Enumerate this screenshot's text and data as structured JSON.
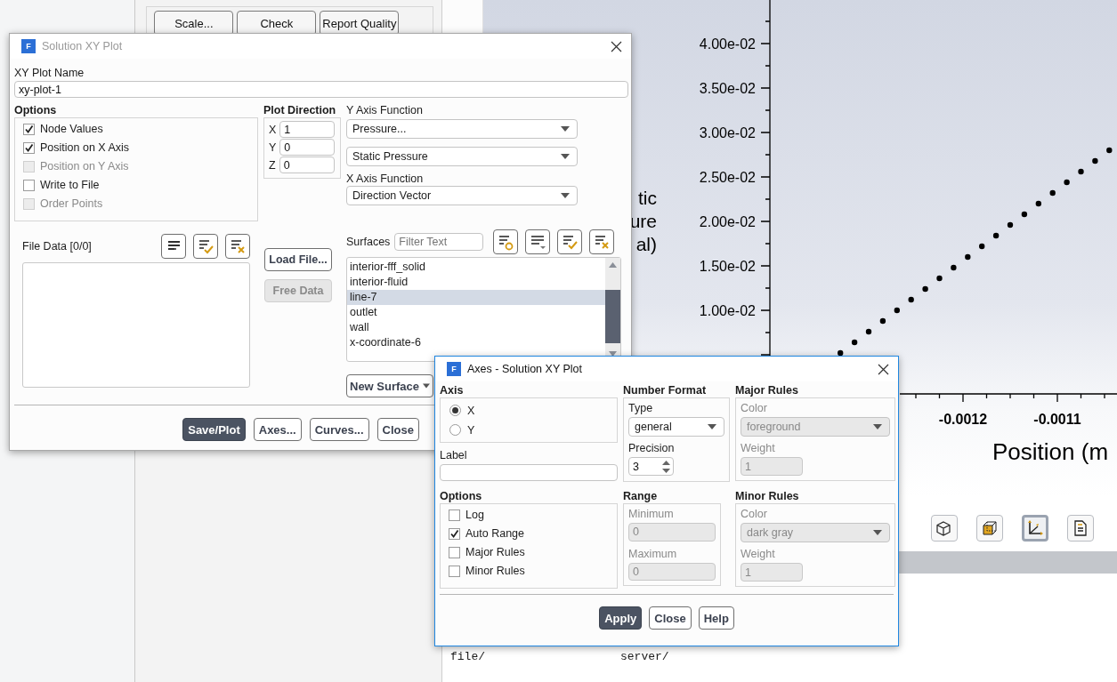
{
  "left_panel": {
    "mesh_buttons": [
      "Scale...",
      "Check",
      "Report Quality"
    ]
  },
  "graphics": {
    "chart_data": {
      "type": "scatter",
      "xlabel": "Position (m",
      "ylabel": "tic ure al)",
      "x": [
        -0.00133,
        -0.001315,
        -0.0013,
        -0.001285,
        -0.00127,
        -0.001255,
        -0.00124,
        -0.001225,
        -0.00121,
        -0.001195,
        -0.00118,
        -0.001165,
        -0.00115,
        -0.001135,
        -0.00112,
        -0.001105,
        -0.00109,
        -0.001075,
        -0.00106,
        -0.001045
      ],
      "series": [
        {
          "color": "#000000",
          "values": [
            0.0052,
            0.0064,
            0.0076,
            0.0088,
            0.01,
            0.0112,
            0.0124,
            0.0136,
            0.0148,
            0.016,
            0.0172,
            0.0184,
            0.0196,
            0.0208,
            0.022,
            0.0232,
            0.0244,
            0.0256,
            0.0268,
            0.028
          ]
        }
      ],
      "xticks": [
        {
          "value": -0.0012,
          "label": "-0.0012"
        },
        {
          "value": -0.0011,
          "label": "-0.0011"
        }
      ],
      "yticks": [
        {
          "value": 0.04,
          "label": "4.00e-02"
        },
        {
          "value": 0.035,
          "label": "3.50e-02"
        },
        {
          "value": 0.03,
          "label": "3.00e-02"
        },
        {
          "value": 0.025,
          "label": "2.50e-02"
        },
        {
          "value": 0.02,
          "label": "2.00e-02"
        },
        {
          "value": 0.015,
          "label": "1.50e-02"
        },
        {
          "value": 0.01,
          "label": "1.00e-02"
        }
      ],
      "xlim": [
        -0.0014047,
        -0.0010368
      ],
      "ylim": [
        0.0006,
        0.0449
      ]
    },
    "toolbar": [
      {
        "kind": "cube",
        "selected": false
      },
      {
        "kind": "box",
        "selected": false
      },
      {
        "kind": "axes",
        "selected": true
      },
      {
        "kind": "note",
        "selected": false
      }
    ]
  },
  "console": {
    "lines": [
      [
        "file/",
        "server/"
      ]
    ]
  },
  "xy_plot_dialog": {
    "title": "Solution XY Plot",
    "icon_letter": "F",
    "active": false,
    "name_label": "XY Plot Name",
    "name_value": "xy-plot-1",
    "options": {
      "label": "Options",
      "items": [
        {
          "label": "Node Values",
          "checked": true,
          "disabled": false
        },
        {
          "label": "Position on X Axis",
          "checked": true,
          "disabled": false
        },
        {
          "label": "Position on Y Axis",
          "checked": false,
          "disabled": true
        },
        {
          "label": "Write to File",
          "checked": false,
          "disabled": false
        },
        {
          "label": "Order Points",
          "checked": false,
          "disabled": true
        }
      ]
    },
    "plot_direction": {
      "label": "Plot Direction",
      "fields": [
        {
          "axis": "X",
          "value": "1"
        },
        {
          "axis": "Y",
          "value": "0"
        },
        {
          "axis": "Z",
          "value": "0"
        }
      ]
    },
    "y_axis_function": {
      "label": "Y Axis Function",
      "selects": [
        "Pressure...",
        "Static Pressure"
      ]
    },
    "x_axis_function": {
      "label": "X Axis Function",
      "select": "Direction Vector"
    },
    "file_data": {
      "label": "File Data  [0/0]",
      "tools": [
        {
          "kind": "list"
        },
        {
          "kind": "check"
        },
        {
          "kind": "clear"
        }
      ]
    },
    "file_buttons": [
      {
        "label": "Load File...",
        "disabled": false
      },
      {
        "label": "Free Data",
        "disabled": true
      }
    ],
    "surfaces": {
      "label": "Surfaces",
      "filter_placeholder": "Filter Text",
      "tools": [
        {
          "kind": "circle"
        },
        {
          "kind": "caret"
        },
        {
          "kind": "check"
        },
        {
          "kind": "clear"
        }
      ],
      "items": [
        {
          "label": "interior-fff_solid",
          "selected": false
        },
        {
          "label": "interior-fluid",
          "selected": false
        },
        {
          "label": "line-7",
          "selected": true
        },
        {
          "label": "outlet",
          "selected": false
        },
        {
          "label": "wall",
          "selected": false
        },
        {
          "label": "x-coordinate-6",
          "selected": false
        }
      ]
    },
    "new_surface": "New Surface",
    "buttons": [
      {
        "label": "Save/Plot",
        "primary": true
      },
      {
        "label": "Axes...",
        "primary": false
      },
      {
        "label": "Curves...",
        "primary": false
      },
      {
        "label": "Close",
        "primary": false
      }
    ]
  },
  "axes_dialog": {
    "title": "Axes - Solution XY Plot",
    "icon_letter": "F",
    "active": true,
    "axis": {
      "label": "Axis",
      "options": [
        {
          "label": "X",
          "selected": true
        },
        {
          "label": "Y",
          "selected": false
        }
      ]
    },
    "label_field": {
      "label": "Label"
    },
    "number_format": {
      "label": "Number Format",
      "type_label": "Type",
      "type_value": "general",
      "precision_label": "Precision",
      "precision_value": "3"
    },
    "major_rules": {
      "label": "Major Rules",
      "disabled": true,
      "color_label": "Color",
      "color_value": "foreground",
      "weight_label": "Weight",
      "weight_value": "1"
    },
    "options": {
      "label": "Options",
      "items": [
        {
          "label": "Log",
          "checked": false
        },
        {
          "label": "Auto Range",
          "checked": true
        },
        {
          "label": "Major Rules",
          "checked": false
        },
        {
          "label": "Minor Rules",
          "checked": false
        }
      ]
    },
    "range": {
      "label": "Range",
      "disabled": true,
      "minimum_label": "Minimum",
      "minimum_value": "0",
      "maximum_label": "Maximum",
      "maximum_value": "0"
    },
    "minor_rules": {
      "label": "Minor Rules",
      "disabled": true,
      "color_label": "Color",
      "color_value": "dark gray",
      "weight_label": "Weight",
      "weight_value": "1"
    },
    "buttons": [
      {
        "label": "Apply",
        "primary": true
      },
      {
        "label": "Close",
        "primary": false
      },
      {
        "label": "Help",
        "primary": false
      }
    ]
  }
}
